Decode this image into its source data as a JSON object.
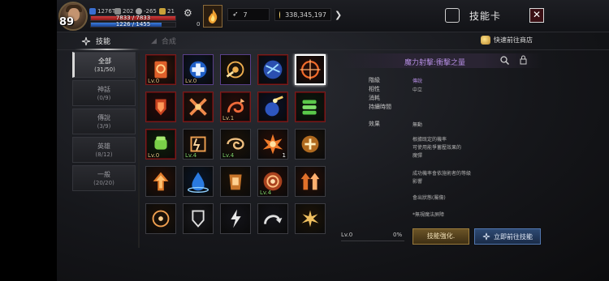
{
  "player": {
    "level": "89",
    "stat_power": "1276T",
    "stat_a": "202",
    "stat_b": "-265",
    "stat_c": "21",
    "hp_text": "7833 / 7833",
    "mp_text": "1226 / 1455",
    "hp_fraction": 1.0,
    "mp_fraction": 0.84,
    "buff_count": "0"
  },
  "currencies": {
    "feather": "7",
    "gold": "338,345,197"
  },
  "window": {
    "title": "技能卡",
    "close_label": "✕",
    "shop_link": "快速前往商店"
  },
  "tabs": [
    {
      "label": "技能"
    },
    {
      "label": "合成"
    }
  ],
  "categories": [
    {
      "name": "全部",
      "count": "(31/50)"
    },
    {
      "name": "神話",
      "count": "(0/9)"
    },
    {
      "name": "傳說",
      "count": "(3/9)"
    },
    {
      "name": "英雄",
      "count": "(8/12)"
    },
    {
      "name": "一般",
      "count": "(20/20)"
    }
  ],
  "skills": [
    {
      "lv": "Lv.0",
      "num": "",
      "border": "red",
      "icon": "orange-scroll-icon"
    },
    {
      "lv": "Lv.0",
      "num": "",
      "border": "purple",
      "icon": "blue-cross-icon"
    },
    {
      "lv": "",
      "num": "",
      "border": "purple",
      "icon": "target-hand-icon"
    },
    {
      "lv": "",
      "num": "",
      "border": "red",
      "icon": "blue-lightning-icon"
    },
    {
      "lv": "",
      "num": "",
      "border": "red",
      "icon": "crosshair-burst-icon"
    },
    {
      "lv": "",
      "num": "",
      "border": "red",
      "icon": "red-shield-icon"
    },
    {
      "lv": "",
      "num": "",
      "border": "red",
      "icon": "crossed-blades-icon"
    },
    {
      "lv": "Lv.1",
      "num": "",
      "border": "red",
      "icon": "spiral-arrow-icon"
    },
    {
      "lv": "",
      "num": "",
      "border": "red",
      "icon": "meteor-orb-icon"
    },
    {
      "lv": "",
      "num": "",
      "border": "red",
      "icon": "green-bullets-icon"
    },
    {
      "lv": "Lv.0",
      "num": "",
      "border": "red",
      "icon": "green-fist-icon"
    },
    {
      "lv": "Lv.4",
      "num": "",
      "border": "gray",
      "icon": "rune-bolt-icon",
      "lv_green": true
    },
    {
      "lv": "Lv.4",
      "num": "",
      "border": "gray",
      "icon": "swirl-wind-icon",
      "lv_green": true
    },
    {
      "lv": "",
      "num": "1",
      "border": "gray",
      "icon": "explosion-icon"
    },
    {
      "lv": "",
      "num": "",
      "border": "gray",
      "icon": "plus-orb-icon"
    },
    {
      "lv": "",
      "num": "",
      "border": "gray",
      "icon": "up-arrow-icon"
    },
    {
      "lv": "",
      "num": "",
      "border": "gray",
      "icon": "water-splash-icon"
    },
    {
      "lv": "",
      "num": "",
      "border": "gray",
      "icon": "armor-icon"
    },
    {
      "lv": "Lv.4",
      "num": "",
      "border": "gray",
      "icon": "seal-emblem-icon",
      "lv_green": true
    },
    {
      "lv": "",
      "num": "",
      "border": "gray",
      "icon": "double-arrow-icon"
    },
    {
      "lv": "",
      "num": "",
      "border": "gray",
      "icon": "target-small-icon"
    },
    {
      "lv": "",
      "num": "",
      "border": "gray",
      "icon": "shield-small-icon"
    },
    {
      "lv": "",
      "num": "",
      "border": "gray",
      "icon": "bolt-small-icon"
    },
    {
      "lv": "",
      "num": "",
      "border": "gray",
      "icon": "curve-arrow-icon"
    },
    {
      "lv": "",
      "num": "",
      "border": "gray",
      "icon": "burst-small-icon"
    }
  ],
  "detail": {
    "name": "魔力射擊:衝擊之量",
    "rows": [
      {
        "label": "階級",
        "value": "傳說",
        "purple": true
      },
      {
        "label": "相性",
        "value": "中立"
      },
      {
        "label": "消耗",
        "value": ""
      },
      {
        "label": "持續時間",
        "value": ""
      },
      {
        "label": "效果",
        "value": "無動"
      }
    ],
    "description": [
      "根據既定的機率",
      "可使用能爭蓄壓效果的",
      "魔彈",
      "成功機率會依施術者的等級",
      "影響",
      "會出狀態(屬傷)",
      "*無視魔法屏障"
    ],
    "progress_level": "Lv.0",
    "progress_percent": "0%",
    "enhance_label": "技能強化.",
    "goto_label": "立即前往技能"
  }
}
